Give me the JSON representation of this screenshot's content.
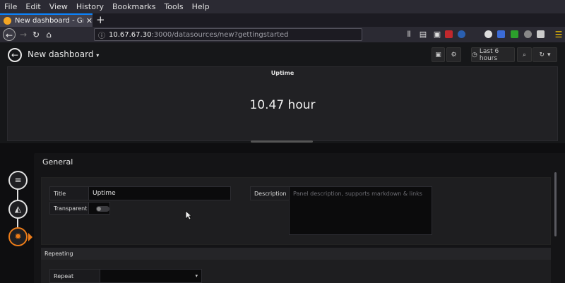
{
  "browser": {
    "menu": [
      "File",
      "Edit",
      "View",
      "History",
      "Bookmarks",
      "Tools",
      "Help"
    ],
    "tab_title": "New dashboard - Grafana",
    "url_host": "10.67.67.30",
    "url_path": ":3000/datasources/new?gettingstarted"
  },
  "grafana": {
    "dashboard_title": "New dashboard",
    "time_range": "Last 6 hours"
  },
  "panel": {
    "title": "Uptime",
    "value": "10.47 hour"
  },
  "editor": {
    "section_title": "General",
    "title_label": "Title",
    "title_value": "Uptime",
    "transparent_label": "Transparent",
    "transparent_on": false,
    "description_label": "Description",
    "description_placeholder": "Panel description, supports markdown & links",
    "repeating_title": "Repeating",
    "repeat_label": "Repeat"
  },
  "colors": {
    "accent": "#eb7b18",
    "browser_highlight": "#0a84ff"
  }
}
